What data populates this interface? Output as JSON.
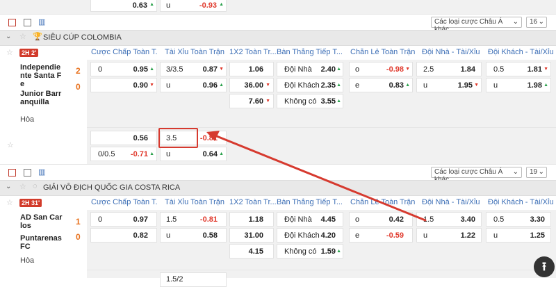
{
  "top_row": {
    "v1": "0.63",
    "label": "u",
    "v2": "-0.93"
  },
  "bet_type_select": "Các loại cược Châu Á khác",
  "headers": [
    "Cược Chấp Toàn T...",
    "Tài Xỉu Toàn Trận",
    "1X2 Toàn Tr...",
    "Bàn Thắng Tiếp T...",
    "Chẵn Lẻ Toàn Trận",
    "Đội Nhà - Tài/Xỉu",
    "Đội Khách - Tài/Xỉu"
  ],
  "league1": {
    "name": "SIÊU CÚP COLOMBIA",
    "count": "16",
    "match": {
      "time": "2H 2'",
      "home": "Independie nte Santa F e",
      "away": "Junior Barr anquilla",
      "draw": "Hòa",
      "home_score": "2",
      "away_score": "0",
      "hcp": {
        "line1": "0",
        "v1": "0.95",
        "v2": "0.90"
      },
      "ou": {
        "line1": "3/3.5",
        "v1": "0.87",
        "label2": "u",
        "v2": "0.96"
      },
      "x12": [
        "1.06",
        "36.00",
        "7.60"
      ],
      "next_goal": [
        {
          "label": "Đội Nhà",
          "v": "2.40"
        },
        {
          "label": "Đội Khách",
          "v": "2.35"
        },
        {
          "label": "Không có",
          "v": "3.55"
        }
      ],
      "odd_even": {
        "l1": "o",
        "v1": "-0.98",
        "l2": "e",
        "v2": "0.83"
      },
      "home_ou": {
        "line": "2.5",
        "v1": "1.84",
        "label2": "u",
        "v2": "1.95"
      },
      "away_ou": {
        "line": "0.5",
        "v1": "1.81",
        "label2": "u",
        "v2": "1.98"
      },
      "extra": {
        "hcp_v1": "0.56",
        "ou_line": "3.5",
        "ou_v1": "-0.81",
        "hcp_line2": "0/0.5",
        "hcp_v2": "-0.71",
        "ou_label2": "u",
        "ou_v2": "0.64"
      }
    }
  },
  "league2": {
    "name": "GIẢI VÔ ĐỊCH QUỐC GIA COSTA RICA",
    "count": "19",
    "match": {
      "time": "2H 31'",
      "home": "AD San Car los",
      "away": "Puntarenas FC",
      "draw": "Hòa",
      "home_score": "1",
      "away_score": "0",
      "hcp": {
        "line1": "0",
        "v1": "0.97",
        "v2": "0.82"
      },
      "ou": {
        "line1": "1.5",
        "v1": "-0.81",
        "label2": "u",
        "v2": "0.58"
      },
      "x12": [
        "1.18",
        "31.00",
        "4.15"
      ],
      "next_goal": [
        {
          "label": "Đội Nhà",
          "v": "4.45"
        },
        {
          "label": "Đội Khách",
          "v": "4.20"
        },
        {
          "label": "Không có",
          "v": "1.59"
        }
      ],
      "odd_even": {
        "l1": "o",
        "v1": "0.42",
        "l2": "e",
        "v2": "-0.59"
      },
      "home_ou": {
        "line": "1.5",
        "v1": "3.40",
        "label2": "u",
        "v2": "1.22"
      },
      "away_ou": {
        "line": "0.5",
        "v1": "3.30",
        "label2": "u",
        "v2": "1.25"
      }
    }
  },
  "bottom_partial": {
    "v1": "1.5/2"
  },
  "colors": {
    "header_text": "#3d6fb6",
    "negative": "#e0382b",
    "up": "#2aa14b",
    "badge": "#d23b2b",
    "annotation": "#d63a2f"
  }
}
